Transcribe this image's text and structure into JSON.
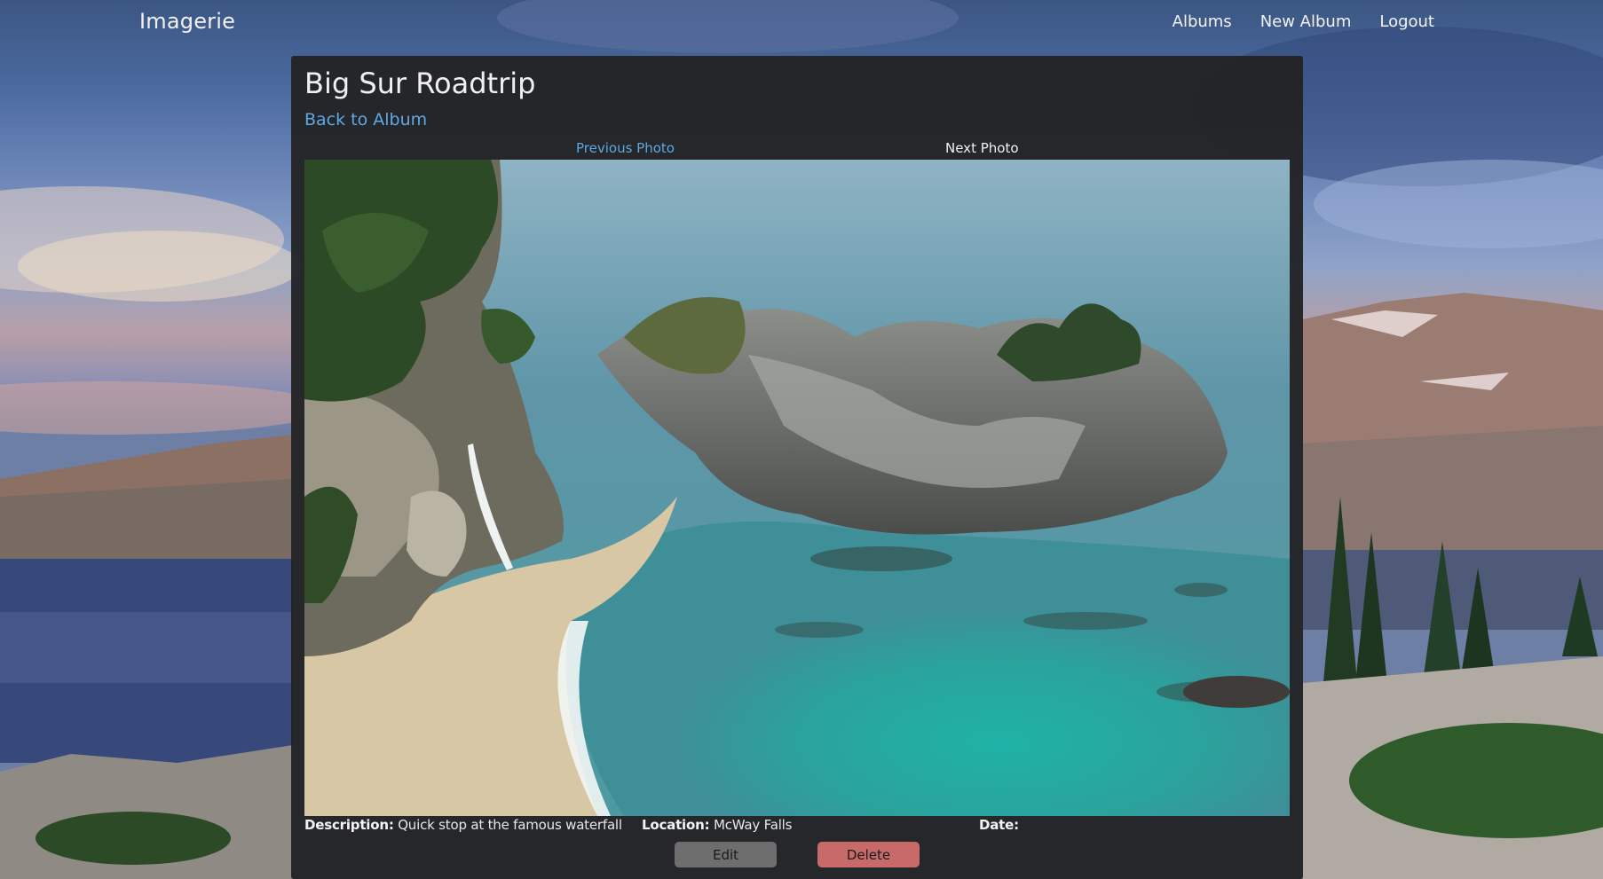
{
  "nav": {
    "brand": "Imagerie",
    "links": [
      "Albums",
      "New Album",
      "Logout"
    ]
  },
  "page": {
    "title": "Big Sur Roadtrip",
    "back_link": "Back to Album",
    "prev_link": "Previous Photo",
    "next_link": "Next Photo"
  },
  "photo": {
    "description_label": "Description:",
    "description_value": "Quick stop at the famous waterfall",
    "location_label": "Location:",
    "location_value": "McWay Falls",
    "date_label": "Date:",
    "date_value": ""
  },
  "actions": {
    "edit_label": "Edit",
    "delete_label": "Delete"
  },
  "colors": {
    "link": "#5fa8e2",
    "panel": "#222324",
    "edit_button": "#6e6e6e",
    "delete_button": "#c86a6a"
  }
}
